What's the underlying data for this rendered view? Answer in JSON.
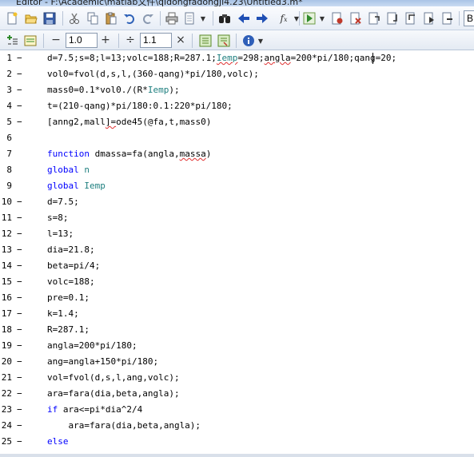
{
  "window": {
    "title": "Editor - F:\\Academic\\matlab文件\\qidongfadongji4.23\\Untitled3.m*"
  },
  "toolbar2": {
    "width_value": "1.0",
    "step_value": "1.1",
    "minus_label": "−",
    "plus_label": "+",
    "divide_label": "÷",
    "times_label": "×"
  },
  "editor": {
    "lines": [
      {
        "num": "1",
        "mark": "−",
        "code": "d=7.5;s=8;l=13;volc=188;R=287.1;Iemp=298;angla=200*pi/180;qang=20;"
      },
      {
        "num": "2",
        "mark": "−",
        "code": "vol0=fvol(d,s,l,(360-qang)*pi/180,volc);"
      },
      {
        "num": "3",
        "mark": "−",
        "code": "mass0=0.1*vol0./(R*Iemp);"
      },
      {
        "num": "4",
        "mark": "−",
        "code": "t=(210-qang)*pi/180:0.1:220*pi/180;"
      },
      {
        "num": "5",
        "mark": "−",
        "code": "[anng2,mall]=ode45(@fa,t,mass0)"
      },
      {
        "num": "6",
        "mark": "",
        "code": ""
      },
      {
        "num": "7",
        "mark": "",
        "code": "function dmassa=fa(angla,massa)"
      },
      {
        "num": "8",
        "mark": "",
        "code": "global n"
      },
      {
        "num": "9",
        "mark": "",
        "code": "global Iemp"
      },
      {
        "num": "10",
        "mark": "−",
        "code": "d=7.5;"
      },
      {
        "num": "11",
        "mark": "−",
        "code": "s=8;"
      },
      {
        "num": "12",
        "mark": "−",
        "code": "l=13;"
      },
      {
        "num": "13",
        "mark": "−",
        "code": "dia=21.8;"
      },
      {
        "num": "14",
        "mark": "−",
        "code": "beta=pi/4;"
      },
      {
        "num": "15",
        "mark": "−",
        "code": "volc=188;"
      },
      {
        "num": "16",
        "mark": "−",
        "code": "pre=0.1;"
      },
      {
        "num": "17",
        "mark": "−",
        "code": "k=1.4;"
      },
      {
        "num": "18",
        "mark": "−",
        "code": "R=287.1;"
      },
      {
        "num": "19",
        "mark": "−",
        "code": "angla=200*pi/180;"
      },
      {
        "num": "20",
        "mark": "−",
        "code": "ang=angla+150*pi/180;"
      },
      {
        "num": "21",
        "mark": "−",
        "code": "vol=fvol(d,s,l,ang,volc);"
      },
      {
        "num": "22",
        "mark": "−",
        "code": "ara=fara(dia,beta,angla);"
      },
      {
        "num": "23",
        "mark": "−",
        "code": "if ara<=pi*dia^2/4"
      },
      {
        "num": "24",
        "mark": "−",
        "code": "    ara=fara(dia,beta,angla);"
      },
      {
        "num": "25",
        "mark": "−",
        "code": "else"
      }
    ]
  },
  "colors": {
    "keyword": "#0000ff",
    "variable": "#208080",
    "accent": "#3a6fc4"
  }
}
